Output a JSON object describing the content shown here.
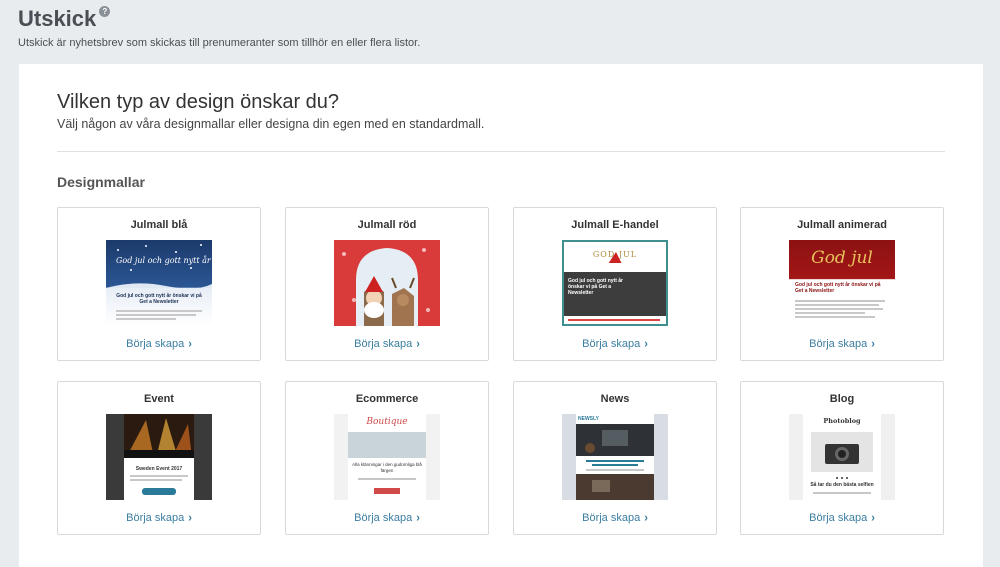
{
  "header": {
    "title": "Utskick",
    "help_symbol": "?",
    "subtitle": "Utskick är nyhetsbrev som skickas till prenumeranter som tillhör en eller flera listor."
  },
  "panel": {
    "heading": "Vilken typ av design önskar du?",
    "description": "Välj någon av våra designmallar eller designa din egen med en standardmall.",
    "section_title": "Designmallar"
  },
  "templates": [
    {
      "name": "Julmall blå",
      "cta": "Börja skapa"
    },
    {
      "name": "Julmall röd",
      "cta": "Börja skapa"
    },
    {
      "name": "Julmall E-handel",
      "cta": "Börja skapa"
    },
    {
      "name": "Julmall animerad",
      "cta": "Börja skapa"
    },
    {
      "name": "Event",
      "cta": "Börja skapa"
    },
    {
      "name": "Ecommerce",
      "cta": "Börja skapa"
    },
    {
      "name": "News",
      "cta": "Börja skapa"
    },
    {
      "name": "Blog",
      "cta": "Börja skapa"
    }
  ],
  "thumb_text": {
    "blue_script": "God jul och gott nytt år",
    "blue_headline": "God jul och gott nytt år önskar vi på Get a Newsletter",
    "ehandel_logo": "GOD   JUL",
    "ehandel_headline": "God jul och gott nytt år önskar vi på Get a Newsletter",
    "animerad_script": "God jul",
    "animerad_headline": "God jul och gott nytt år önskar vi på Get a Newsletter",
    "event_headline": "Sweden Event 2017",
    "ecom_logo": "Boutique",
    "ecom_headline": "Alla klänningar i den gudomliga blå färgen",
    "news_logo": "NEWSLY",
    "blog_logo": "Photoblog",
    "blog_headline": "Så tar du den bästa selfien"
  },
  "colors": {
    "cta": "#3b7ea1",
    "background": "#e9ecef"
  },
  "icons": {
    "help": "question-circle-icon",
    "cta": "chevron-right-icon"
  }
}
